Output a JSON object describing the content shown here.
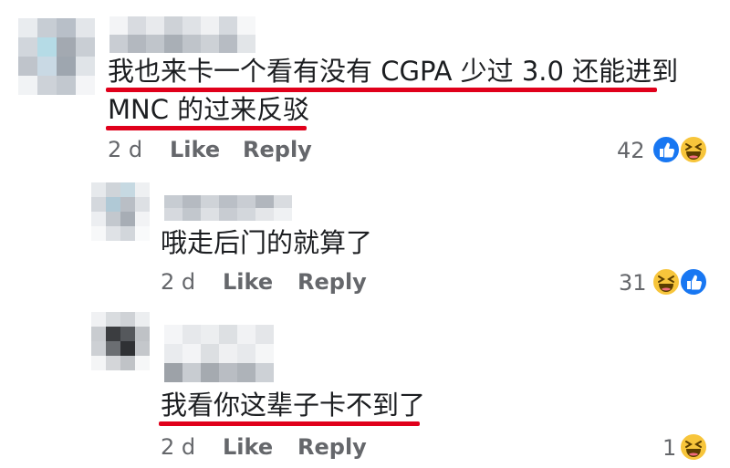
{
  "comments": [
    {
      "text_lines": [
        "我也来卡一个看有没有 CGPA 少过 3.0 还能进到",
        "MNC 的过来反驳"
      ],
      "time": "2 d",
      "like": "Like",
      "reply": "Reply",
      "reaction_count": "42",
      "reactions": [
        "like-icon",
        "haha-icon"
      ]
    },
    {
      "text_lines": [
        "哦走后门的就算了"
      ],
      "time": "2 d",
      "like": "Like",
      "reply": "Reply",
      "reaction_count": "31",
      "reactions": [
        "haha-icon",
        "like-icon"
      ]
    },
    {
      "text_lines": [
        "我看你这辈子卡不到了"
      ],
      "time": "2 d",
      "like": "Like",
      "reply": "Reply",
      "reaction_count": "1",
      "reactions": [
        "haha-icon"
      ]
    }
  ],
  "colors": {
    "underline": "#e0001b",
    "meta": "#65676b",
    "like_blue": "#1877f2",
    "haha_yellow": "#f7c53b"
  }
}
